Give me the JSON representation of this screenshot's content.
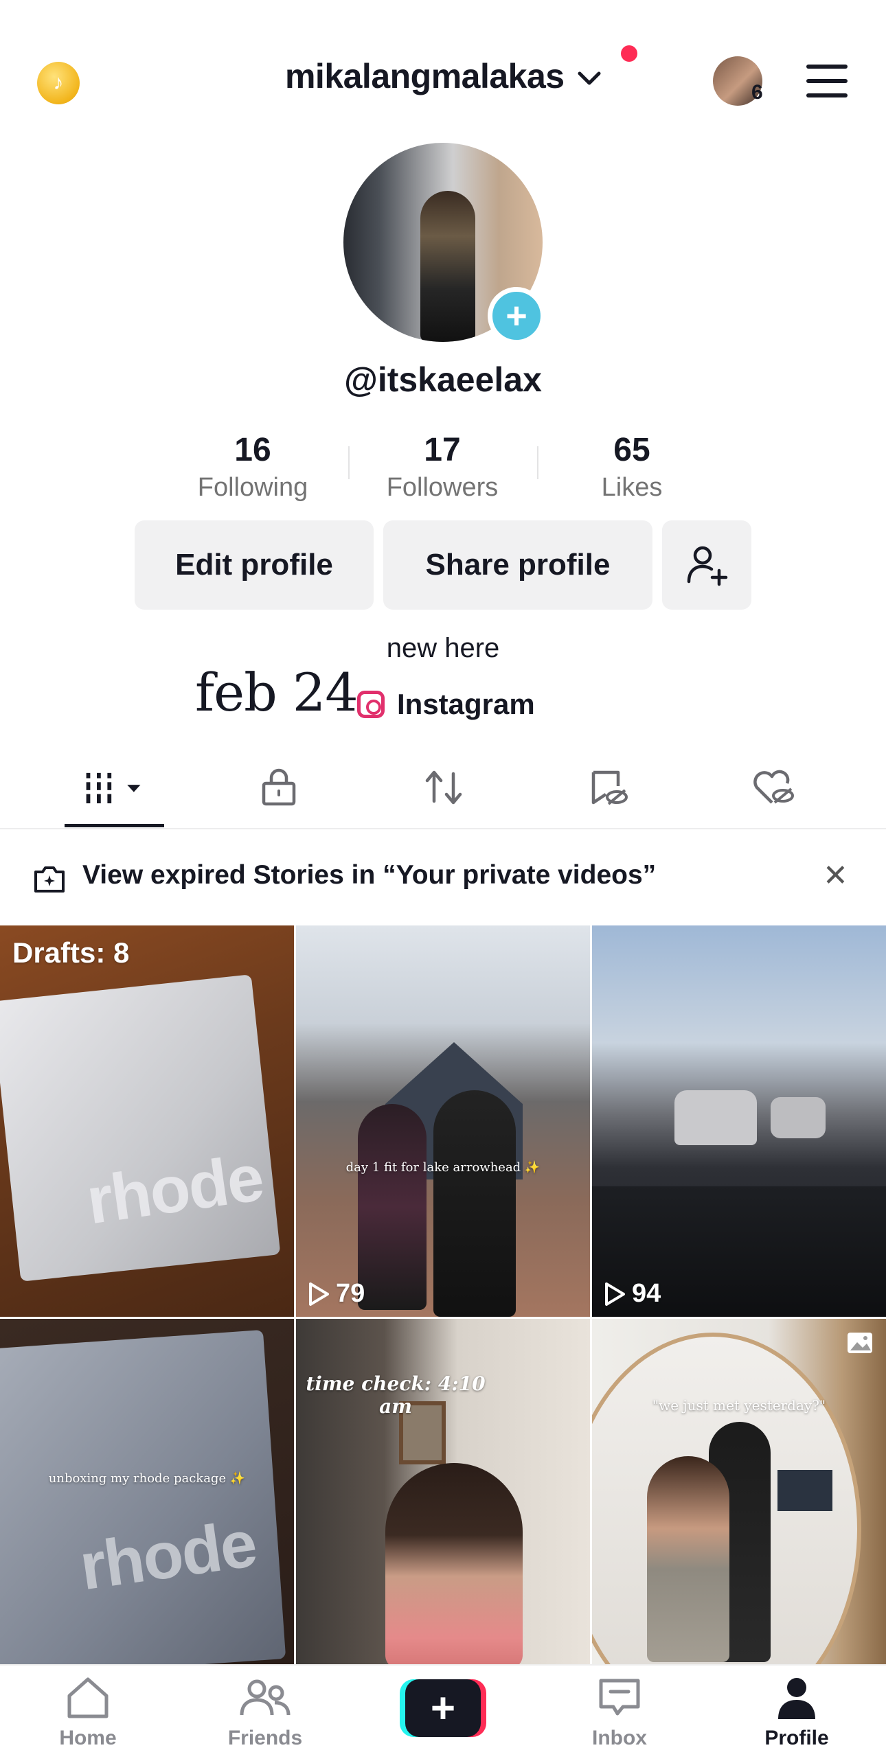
{
  "header": {
    "username": "mikalangmalakas",
    "mini_avatar_badge": "6",
    "coin_icon": "tiktok-coin-icon"
  },
  "profile": {
    "handle": "@itskaeelax",
    "stats": [
      {
        "value": "16",
        "label": "Following"
      },
      {
        "value": "17",
        "label": "Followers"
      },
      {
        "value": "65",
        "label": "Likes"
      }
    ],
    "edit_label": "Edit profile",
    "share_label": "Share profile",
    "bio": "new here",
    "bio_script": "feb 24",
    "link_label": "Instagram"
  },
  "tabs": [
    "videos",
    "private",
    "reposts",
    "favorites",
    "liked"
  ],
  "banner": {
    "text": "View expired Stories in “Your private videos”"
  },
  "grid": [
    {
      "overlay": "Drafts: 8",
      "caption": "",
      "views": ""
    },
    {
      "overlay": "",
      "caption": "day 1 fit for lake arrowhead ✨",
      "views": "79"
    },
    {
      "overlay": "",
      "caption": "",
      "views": "94"
    },
    {
      "overlay": "",
      "caption": "unboxing my rhode package ✨",
      "views": ""
    },
    {
      "overlay": "",
      "caption": "time check: 4:10 am",
      "views": ""
    },
    {
      "overlay": "",
      "caption": "\"we just met yesterday?\"",
      "views": ""
    }
  ],
  "nav": [
    {
      "label": "Home"
    },
    {
      "label": "Friends"
    },
    {
      "label": "Inbox"
    },
    {
      "label": "Profile"
    }
  ],
  "colors": {
    "accent": "#fe2c55",
    "plus_badge": "#4fc3e0",
    "instagram": "#e1306c"
  }
}
